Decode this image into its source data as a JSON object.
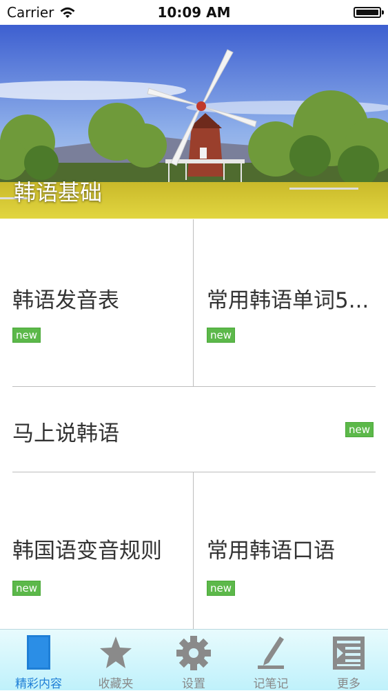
{
  "status_bar": {
    "carrier": "Carrier",
    "time": "10:09 AM"
  },
  "banner": {
    "title": "韩语基础"
  },
  "items": [
    {
      "label": "韩语发音表",
      "badge": "new"
    },
    {
      "label": "常用韩语单词5...",
      "badge": "new"
    },
    {
      "label": "马上说韩语",
      "badge": "new"
    },
    {
      "label": "韩国语变音规则",
      "badge": "new"
    },
    {
      "label": "常用韩语口语",
      "badge": "new"
    }
  ],
  "tabs": [
    {
      "label": "精彩内容",
      "icon": "page-icon",
      "active": true
    },
    {
      "label": "收藏夹",
      "icon": "star-icon",
      "active": false
    },
    {
      "label": "设置",
      "icon": "gear-icon",
      "active": false
    },
    {
      "label": "记笔记",
      "icon": "pen-icon",
      "active": false
    },
    {
      "label": "更多",
      "icon": "list-icon",
      "active": false
    }
  ],
  "colors": {
    "badge": "#5cb84a",
    "tab_active": "#1f7fd6",
    "tab_inactive": "#888888"
  }
}
